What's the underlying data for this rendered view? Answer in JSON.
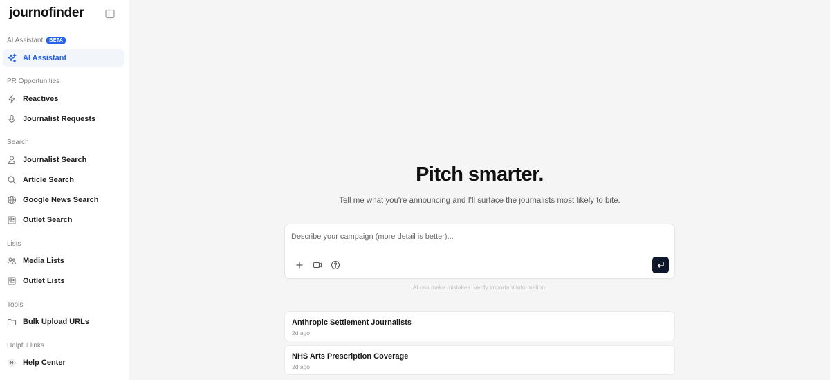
{
  "brand": "journofinder",
  "sidebar": {
    "sections": [
      {
        "label": "AI Assistant",
        "badge": "BETA"
      },
      {
        "label": "PR Opportunities"
      },
      {
        "label": "Search"
      },
      {
        "label": "Lists"
      },
      {
        "label": "Tools"
      },
      {
        "label": "Helpful links"
      }
    ],
    "items": [
      {
        "label": "AI Assistant",
        "icon": "sparkles-icon",
        "active": true
      },
      {
        "label": "Reactives",
        "icon": "lightning-icon"
      },
      {
        "label": "Journalist Requests",
        "icon": "microphone-icon"
      },
      {
        "label": "Journalist Search",
        "icon": "person-icon"
      },
      {
        "label": "Article Search",
        "icon": "search-icon"
      },
      {
        "label": "Google News Search",
        "icon": "globe-icon"
      },
      {
        "label": "Outlet Search",
        "icon": "newspaper-icon"
      },
      {
        "label": "Media Lists",
        "icon": "users-icon"
      },
      {
        "label": "Outlet Lists",
        "icon": "newspaper-icon"
      },
      {
        "label": "Bulk Upload URLs",
        "icon": "folder-icon"
      },
      {
        "label": "Help Center",
        "icon": "help-letter-icon",
        "letter": "H"
      }
    ]
  },
  "main": {
    "title": "Pitch smarter.",
    "subtitle": "Tell me what you're announcing and I'll surface the journalists most likely to bite.",
    "composer": {
      "placeholder": "Describe your campaign (more detail is better)...",
      "tools": [
        "plus-icon",
        "video-icon",
        "help-circle-icon"
      ],
      "send_icon": "enter-arrow-icon"
    },
    "disclaimer": "AI can make mistakes. Verify important information.",
    "recent": [
      {
        "title": "Anthropic Settlement Journalists",
        "time": "2d ago"
      },
      {
        "title": "NHS Arts Prescription Coverage",
        "time": "2d ago"
      }
    ]
  },
  "colors": {
    "accent": "#2563eb",
    "send_button": "#0f172a",
    "background": "#f5f5f5",
    "active_item_bg": "#f2f5fa"
  }
}
